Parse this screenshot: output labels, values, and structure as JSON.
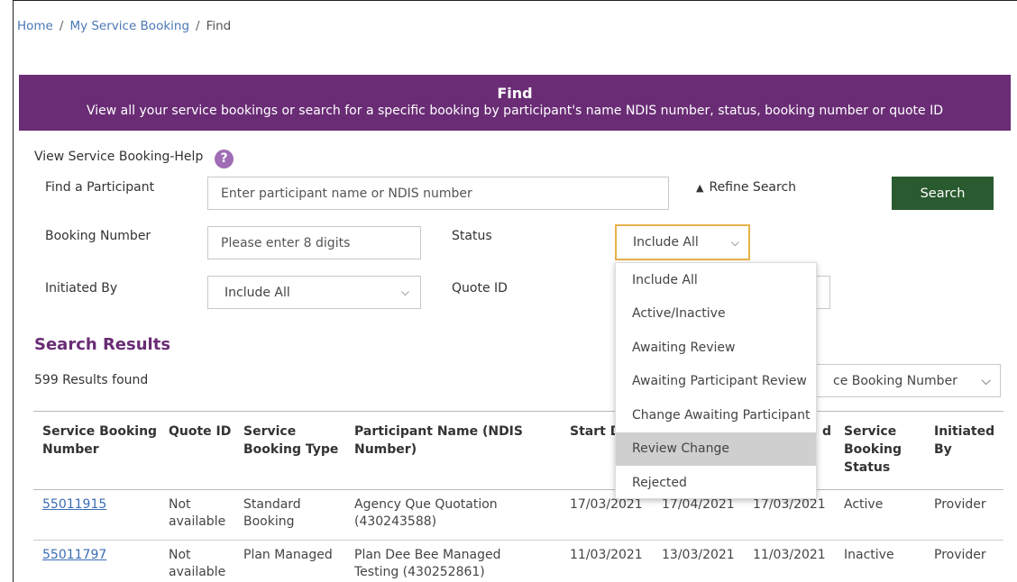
{
  "breadcrumb": {
    "home": "Home",
    "sep": "/",
    "section": "My Service Booking",
    "current": "Find"
  },
  "banner": {
    "title": "Find",
    "subtitle": "View all your service bookings or search for a specific booking by participant's name NDIS number, status, booking number or quote ID"
  },
  "help": {
    "label": "View Service Booking-Help",
    "icon": "?"
  },
  "form": {
    "find_participant_label": "Find a Participant",
    "find_participant_placeholder": "Enter participant name or NDIS number",
    "refine_label": "Refine Search",
    "search_label": "Search",
    "booking_number_label": "Booking Number",
    "booking_number_placeholder": "Please enter 8 digits",
    "status_label": "Status",
    "status_value": "Include All",
    "initiated_by_label": "Initiated By",
    "initiated_by_value": "Include All",
    "quote_id_label": "Quote ID"
  },
  "status_options": [
    "Include All",
    "Active/Inactive",
    "Awaiting Review",
    "Awaiting Participant Review",
    "Change Awaiting Participant",
    "Review Change",
    "Rejected"
  ],
  "results": {
    "title": "Search Results",
    "count": "599 Results found",
    "sort_value": "ce Booking Number"
  },
  "table": {
    "headers": {
      "sb_number": [
        "Service Booking",
        "Number"
      ],
      "quote_id": "Quote ID",
      "sb_type": [
        "Service",
        "Booking Type"
      ],
      "participant": [
        "Participant Name (NDIS",
        "Number)"
      ],
      "start": "Start D",
      "end": "d",
      "status": [
        "Service",
        "Booking",
        "Status"
      ],
      "initiated": [
        "Initiated",
        "By"
      ]
    },
    "rows": [
      {
        "number": "55011915",
        "quote": [
          "Not",
          "available"
        ],
        "type": [
          "Standard",
          "Booking"
        ],
        "participant": [
          "Agency Que Quotation",
          "(430243588)"
        ],
        "start": "17/03/2021",
        "end": "17/04/2021",
        "submitted": "17/03/2021",
        "status": "Active",
        "initiated": "Provider"
      },
      {
        "number": "55011797",
        "quote": [
          "Not",
          "available"
        ],
        "type": [
          "Plan Managed",
          ""
        ],
        "participant": [
          "Plan Dee Bee Managed",
          "Testing (430252861)"
        ],
        "start": "11/03/2021",
        "end": "13/03/2021",
        "submitted": "11/03/2021",
        "status": "Inactive",
        "initiated": "Provider"
      }
    ]
  },
  "colors": {
    "brand_purple": "#6a2c75",
    "search_green": "#2a5a2f",
    "focus_orange": "#e8b24a",
    "link_blue": "#3a6db5"
  }
}
